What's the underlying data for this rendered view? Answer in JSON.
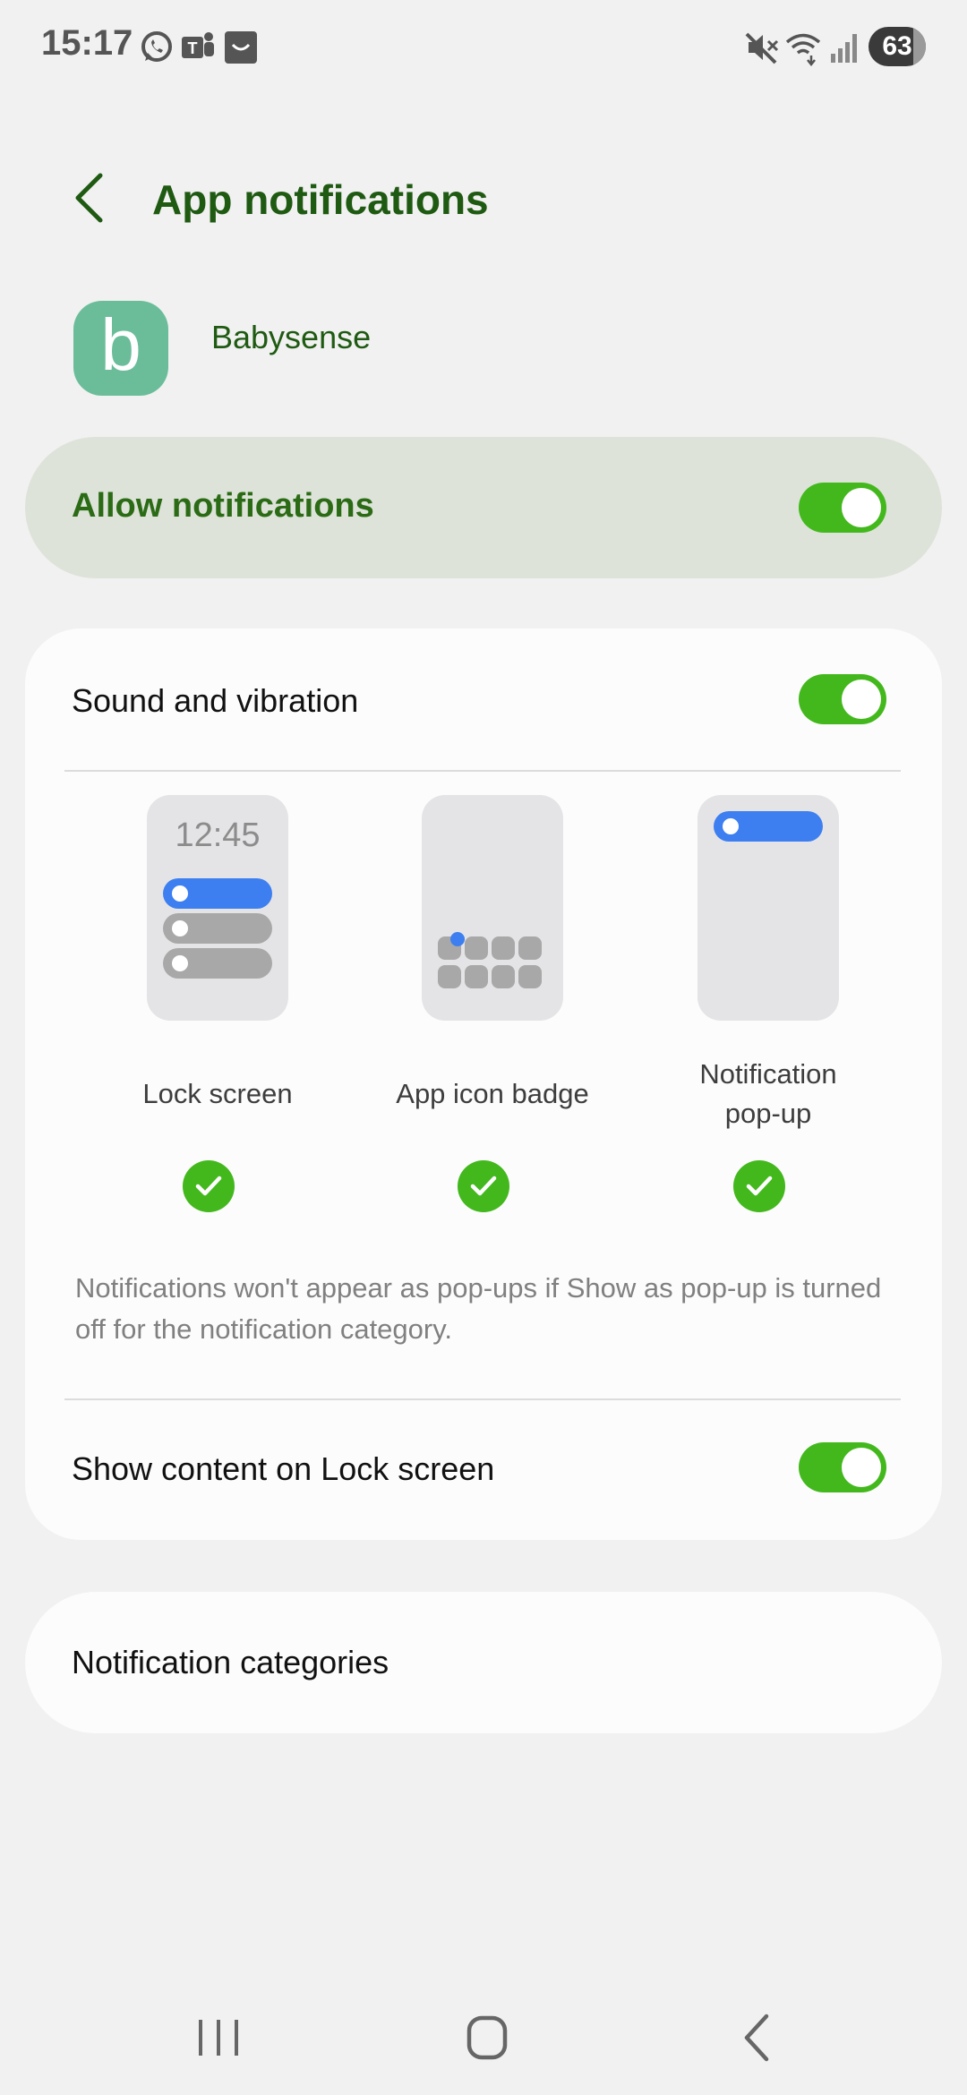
{
  "status_bar": {
    "time": "15:17",
    "battery": "63",
    "notification_icons": [
      "whatsapp-icon",
      "teams-icon",
      "shop-icon"
    ],
    "system_icons": [
      "mute-icon",
      "wifi-icon",
      "signal-icon"
    ]
  },
  "header": {
    "title": "App notifications",
    "back_icon": "chevron-left-icon"
  },
  "app": {
    "icon_letter": "b",
    "name": "Babysense",
    "icon_color": "#6bbd9a"
  },
  "allow_notifications": {
    "label": "Allow notifications",
    "enabled": true
  },
  "sound_vibration": {
    "label": "Sound and vibration",
    "enabled": true
  },
  "notification_styles": [
    {
      "label": "Lock screen",
      "checked": true,
      "preview_clock": "12:45"
    },
    {
      "label": "App icon badge",
      "checked": true
    },
    {
      "label_line1": "Notification",
      "label_line2": "pop-up",
      "checked": true
    }
  ],
  "info_text": "Notifications won't appear as pop-ups if Show as pop-up is turned off for the notification category.",
  "show_content": {
    "label": "Show content on Lock screen",
    "enabled": true
  },
  "categories": {
    "label": "Notification categories"
  },
  "colors": {
    "accent_green": "#43b81d",
    "title_green": "#1f5a12",
    "preview_blue": "#3d7ff0"
  },
  "nav_bar": [
    "recents-icon",
    "home-icon",
    "back-icon"
  ]
}
